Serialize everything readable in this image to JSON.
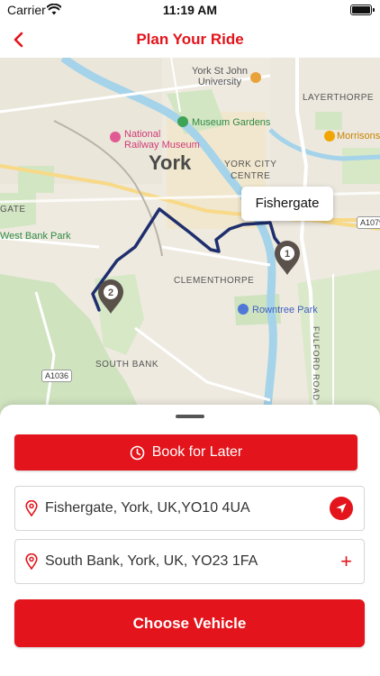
{
  "status_bar": {
    "carrier": "Carrier",
    "time": "11:19 AM"
  },
  "nav": {
    "title": "Plan Your Ride"
  },
  "map": {
    "callout": "Fishergate",
    "labels": {
      "york_st_john": "York St John\nUniversity",
      "layerthorpe": "LAYERTHORPE",
      "museum_gardens": "Museum Gardens",
      "national_railway_museum": "National\nRailway Museum",
      "morrisons": "Morrisons",
      "york": "York",
      "york_city_centre": "YORK CITY\nCENTRE",
      "gate": "GATE",
      "west_bank_park": "West Bank Park",
      "clementhorpe": "CLEMENTHORPE",
      "rowntree_park": "Rowntree Park",
      "south_bank": "SOUTH BANK",
      "fulford_road": "FULFORD ROAD",
      "a1036": "A1036",
      "a1079": "A1079"
    },
    "markers": [
      {
        "number": "1"
      },
      {
        "number": "2"
      }
    ]
  },
  "sheet": {
    "book_later_label": "Book for Later",
    "pickup_address": "Fishergate, York, UK,YO10 4UA",
    "dropoff_address": "South Bank, York, UK, YO23 1FA",
    "add_symbol": "+",
    "choose_vehicle_label": "Choose Vehicle"
  },
  "colors": {
    "brand": "#e3141b",
    "route": "#1f2f6e"
  },
  "icons": {
    "back": "chevron-left-icon",
    "wifi": "wifi-icon",
    "battery": "battery-icon",
    "clock": "clock-icon",
    "pin": "location-pin-icon",
    "locate": "navigation-arrow-icon",
    "marker": "map-marker-icon"
  }
}
